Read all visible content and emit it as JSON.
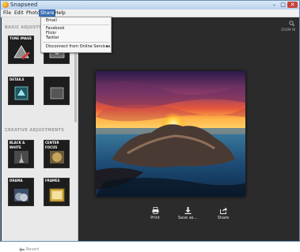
{
  "app": {
    "title": "Snapseed"
  },
  "window_controls": {
    "minimize": "–",
    "maximize": "□",
    "close": "✕"
  },
  "menu": {
    "items": [
      "File",
      "Edit",
      "Photo",
      "Share",
      "Help"
    ],
    "active": "Share"
  },
  "share_menu": {
    "email": "Email",
    "facebook": "Facebook",
    "flickr": "Flickr",
    "twitter": "Twitter",
    "disconnect": "Disconnect from Online Services",
    "submenu_arrow": "▸"
  },
  "sidebar": {
    "basic_title": "BASIC ADJUSTMENTS",
    "creative_title": "CREATIVE ADJUSTMENTS",
    "basic_tiles": [
      "TUNE IMAGE",
      "",
      "DETAILS",
      ""
    ],
    "creative_tiles": [
      "BLACK & WHITE",
      "CENTER FOCUS",
      "DRAMA",
      "FRAMES"
    ],
    "revert": "Revert"
  },
  "main": {
    "zoom_label": "ZOOM IN",
    "actions": [
      "Print",
      "Save as...",
      "Share"
    ]
  },
  "colors": {
    "accent": "#3d6eb5",
    "window_border": "#6a8fb3",
    "main_bg": "#2b2b2b"
  },
  "icons": {
    "app": "snapseed-logo-icon",
    "zoom": "zoom-in-icon",
    "print": "printer-icon",
    "save": "download-icon",
    "share": "share-icon",
    "revert": "revert-arrow-icon"
  }
}
